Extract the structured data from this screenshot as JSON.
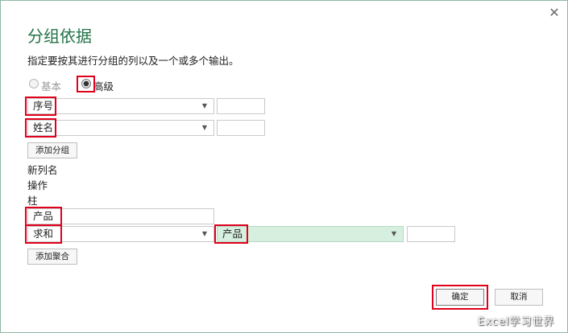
{
  "dialog": {
    "title": "分组依据",
    "description": "指定要按其进行分组的列以及一个或多个输出。",
    "close_glyph": "✕"
  },
  "mode": {
    "basic_label": "基本",
    "advanced_label": "高级",
    "selected": "advanced"
  },
  "grouping": {
    "rows": [
      {
        "column": "序号",
        "value": ""
      },
      {
        "column": "姓名",
        "value": ""
      }
    ],
    "add_button": "添加分组"
  },
  "aggregation": {
    "new_col_header": "新列名",
    "operation_header": "操作",
    "column_header": "柱",
    "new_column_name": "产品",
    "operation": "求和",
    "column": "产品",
    "column_highlight_color": "#d6efdf",
    "add_button": "添加聚合"
  },
  "footer": {
    "ok_label": "确定",
    "cancel_label": "取消"
  },
  "colors": {
    "accent": "#217346",
    "highlight": "#e0001b"
  },
  "watermark": "Excel学习世界"
}
